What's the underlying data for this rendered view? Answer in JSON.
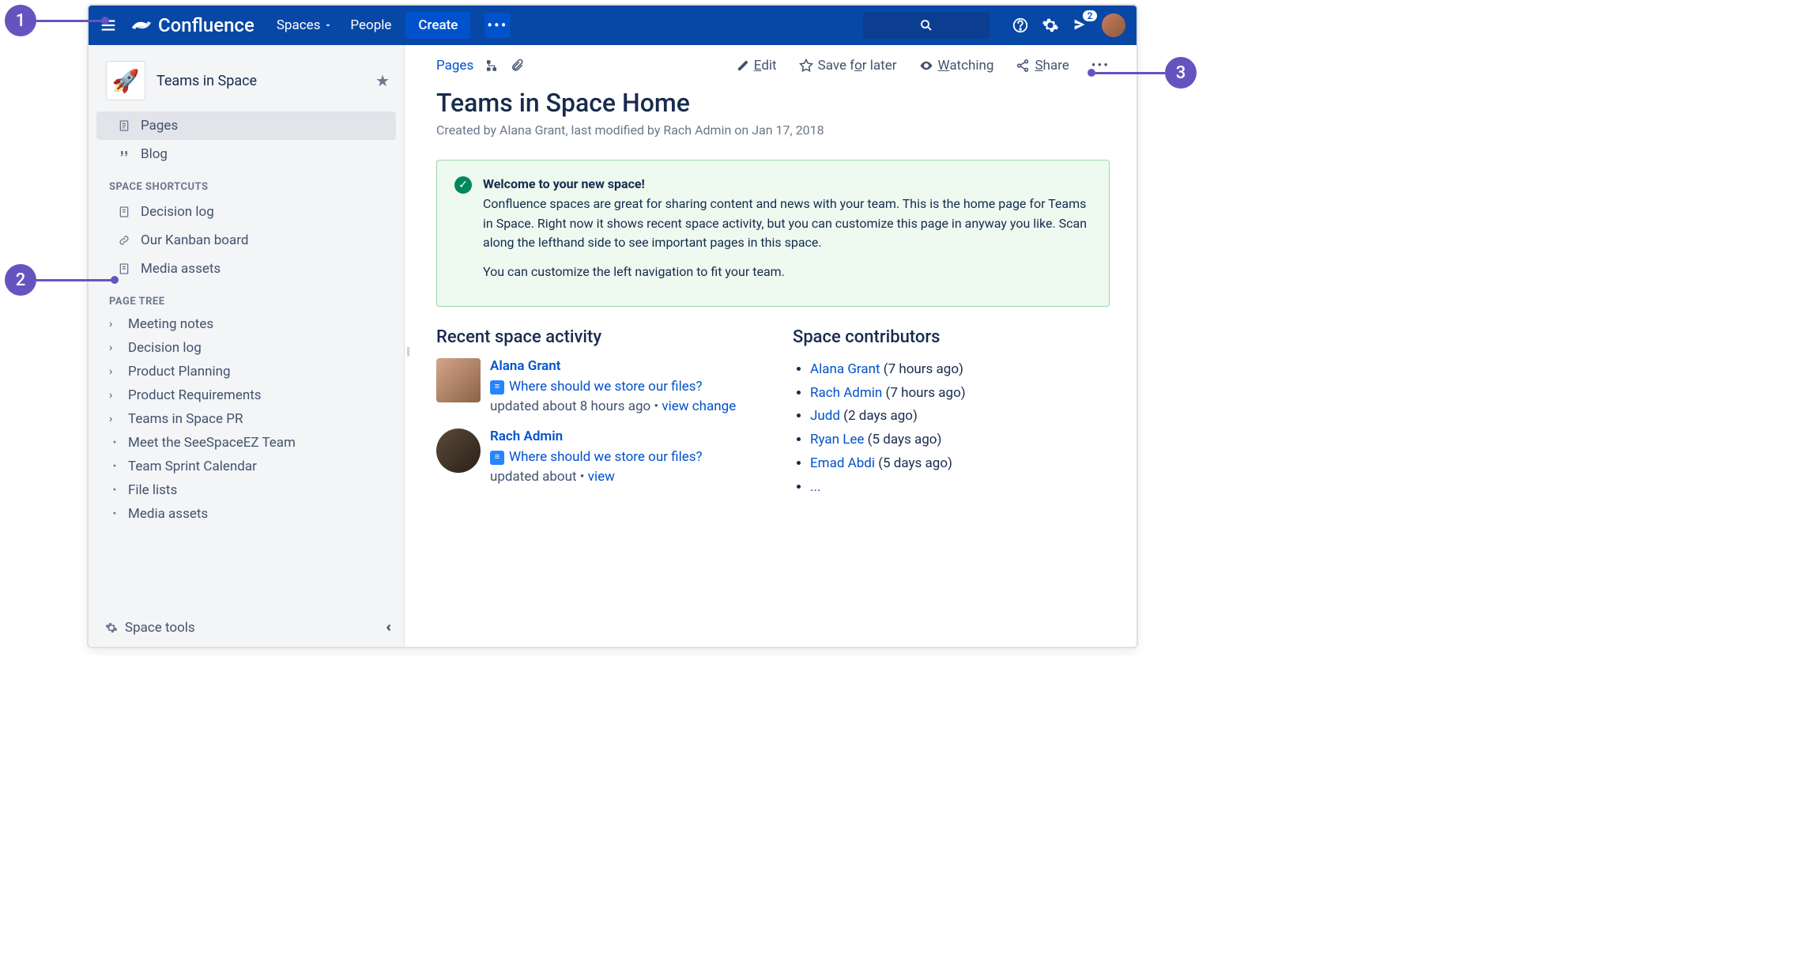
{
  "callouts": {
    "c1": "1",
    "c2": "2",
    "c3": "3"
  },
  "topbar": {
    "brand": "Confluence",
    "spaces": "Spaces",
    "people": "People",
    "create": "Create",
    "notif_badge": "2"
  },
  "sidebar": {
    "space_name": "Teams in Space",
    "pages": "Pages",
    "blog": "Blog",
    "heading_shortcuts": "SPACE SHORTCUTS",
    "shortcuts": [
      {
        "icon": "doc",
        "label": "Decision log"
      },
      {
        "icon": "link",
        "label": "Our Kanban board"
      },
      {
        "icon": "doc",
        "label": "Media assets"
      }
    ],
    "heading_tree": "PAGE TREE",
    "tree": [
      {
        "type": "folder",
        "label": "Meeting notes"
      },
      {
        "type": "folder",
        "label": "Decision log"
      },
      {
        "type": "folder",
        "label": "Product Planning"
      },
      {
        "type": "folder",
        "label": "Product Requirements"
      },
      {
        "type": "folder",
        "label": "Teams in Space PR"
      },
      {
        "type": "leaf",
        "label": "Meet the SeeSpaceEZ Team"
      },
      {
        "type": "leaf",
        "label": "Team Sprint Calendar"
      },
      {
        "type": "leaf",
        "label": "File lists"
      },
      {
        "type": "leaf",
        "label": "Media assets"
      }
    ],
    "space_tools": "Space tools"
  },
  "toolbar": {
    "pages": "Pages",
    "edit_pre": "E",
    "edit_u": "dit",
    "save_pre": "Save f",
    "save_u": "o",
    "save_post": "r later",
    "watch_u": "W",
    "watch_post": "atching",
    "share_u": "S",
    "share_post": "hare"
  },
  "page": {
    "title": "Teams in Space Home",
    "byline": "Created by Alana Grant, last modified by Rach Admin on Jan 17, 2018",
    "panel_title": "Welcome to your new space!",
    "panel_p1": "Confluence spaces are great for sharing content and news with your team. This is the home page for Teams in Space. Right now it shows recent space activity, but you can customize this page in anyway you like. Scan along the lefthand side to see important pages in this space.",
    "panel_p2": "You can customize the left navigation to fit your team."
  },
  "recent": {
    "heading": "Recent space activity",
    "items": [
      {
        "name": "Alana Grant",
        "link": "Where should we store our files?",
        "meta": "updated about 8 hours ago",
        "action": "view change"
      },
      {
        "name": "Rach Admin",
        "link": "Where should we store our files?",
        "meta": "updated about",
        "action": "view"
      }
    ]
  },
  "contribs": {
    "heading": "Space contributors",
    "items": [
      {
        "name": "Alana Grant",
        "time": "(7 hours ago)"
      },
      {
        "name": "Rach Admin",
        "time": "(7 hours ago)"
      },
      {
        "name": "Judd",
        "time": "(2 days ago)"
      },
      {
        "name": "Ryan Lee",
        "time": "(5 days ago)"
      },
      {
        "name": "Emad Abdi",
        "time": "(5 days ago)"
      }
    ],
    "more": "..."
  }
}
